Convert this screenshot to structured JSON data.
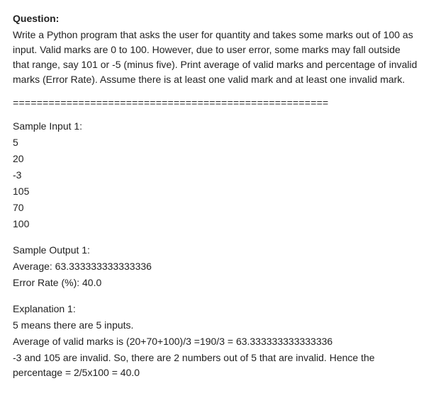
{
  "question": {
    "label": "Question:",
    "body": "Write a Python program that asks the user for quantity and takes some marks out of 100 as input. Valid marks are 0 to 100. However, due to user error, some marks may fall outside that range, say 101 or -5 (minus five). Print average of valid marks and percentage of invalid marks (Error Rate). Assume there is at least one valid mark and at least one invalid mark."
  },
  "separator": "=====================================================",
  "sample_input": {
    "label": "Sample Input 1:",
    "lines": [
      "5",
      "20",
      "-3",
      "105",
      "70",
      "100"
    ]
  },
  "sample_output": {
    "label": "Sample Output 1:",
    "lines": [
      "Average: 63.333333333333336",
      "Error Rate (%): 40.0"
    ]
  },
  "explanation": {
    "label": "Explanation 1:",
    "lines": [
      "5 means there are 5 inputs.",
      "Average of valid marks is (20+70+100)/3 =190/3  = 63.333333333333336",
      "-3 and 105 are invalid. So, there are 2 numbers out of 5 that are invalid. Hence  the percentage = 2/5x100 = 40.0"
    ]
  }
}
